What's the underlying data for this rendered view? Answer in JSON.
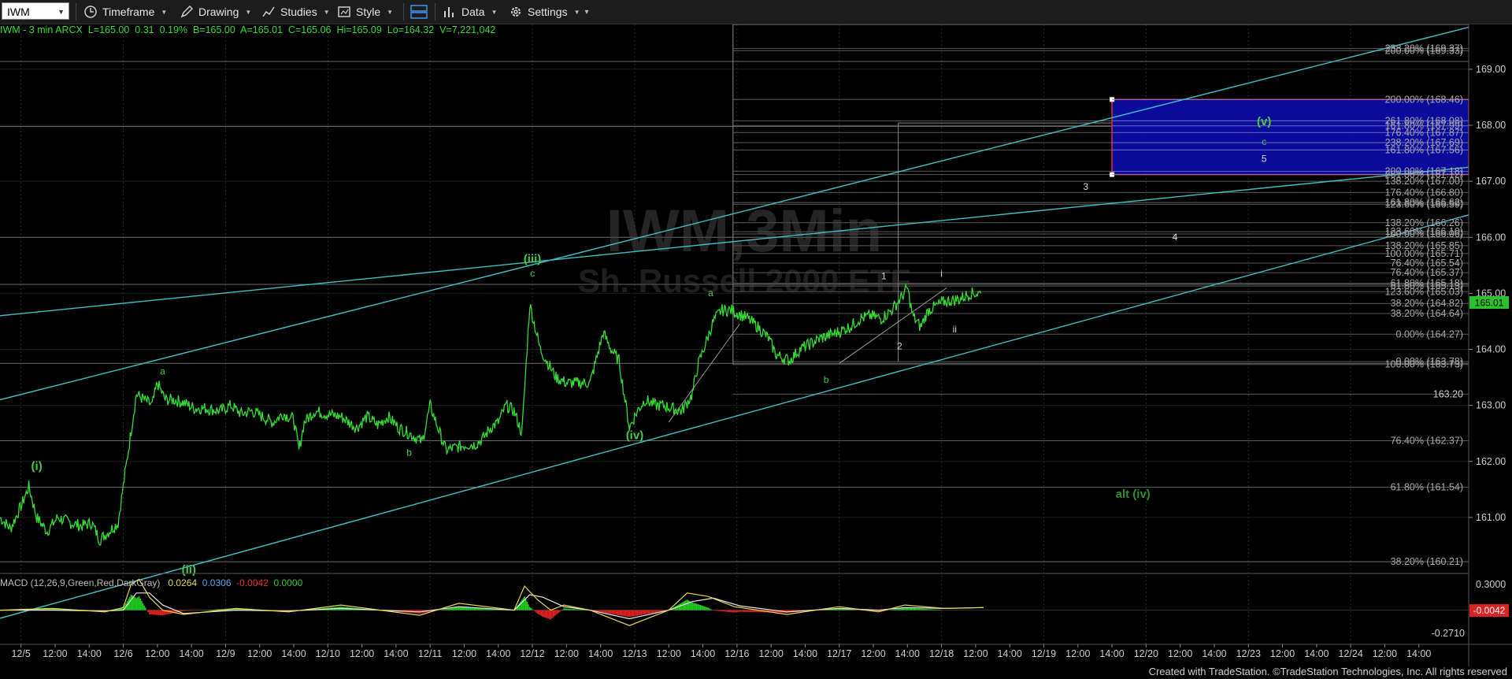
{
  "toolbar": {
    "symbol": "IWM",
    "timeframe_label": "Timeframe",
    "drawing_label": "Drawing",
    "studies_label": "Studies",
    "style_label": "Style",
    "data_label": "Data",
    "settings_label": "Settings"
  },
  "info": {
    "name": "IWM - 3 min  ARCX",
    "last": "L=165.00",
    "chg": "0.31",
    "pct": "0.19%",
    "bid": "B=165.00",
    "ask": "A=165.01",
    "close": "C=165.06",
    "hi": "Hi=165.09",
    "lo": "Lo=164.32",
    "vol": "V=7,221,042"
  },
  "watermark": {
    "line1": "IWM,3Min",
    "line2": "Sh. Russell 2000 ETF"
  },
  "macd_legend": {
    "name": "MACD (12,26,9,Green,Red,DarkGray)",
    "v1": "0.0264",
    "v2": "0.0306",
    "v3": "-0.0042",
    "v4": "0.0000"
  },
  "price_badge": "165.01",
  "macd_badge": "-0.0042",
  "credit": "Created with TradeStation. ©TradeStation Technologies, Inc. All rights reserved",
  "colors": {
    "price": "#33dd33",
    "trend": "#3fc0c8",
    "box_fill": "#0c0ca8",
    "box_border": "#dd3344",
    "wave": "#44cc44"
  },
  "chart_data": {
    "type": "line",
    "title": "IWM - 3 min ARCX",
    "y_range": [
      160.0,
      169.8
    ],
    "price_axis_ticks": [
      "161.00",
      "162.00",
      "163.00",
      "164.00",
      "165.00",
      "166.00",
      "167.00",
      "168.00",
      "169.00"
    ],
    "x_tick_labels": [
      "12/5",
      "12:00",
      "14:00",
      "12/6",
      "12:00",
      "14:00",
      "12/9",
      "12:00",
      "14:00",
      "12/10",
      "12:00",
      "14:00",
      "12/11",
      "12:00",
      "14:00",
      "12/12",
      "12:00",
      "14:00",
      "12/13",
      "12:00",
      "14:00",
      "12/16",
      "12:00",
      "14:00",
      "12/17",
      "12:00",
      "14:00",
      "12/18",
      "12:00",
      "14:00",
      "12/19",
      "12:00",
      "14:00",
      "12/20",
      "12:00",
      "14:00",
      "12/23",
      "12:00",
      "14:00",
      "12/24",
      "12:00",
      "14:00"
    ],
    "series": [
      {
        "x": [
          0,
          4,
          8,
          11,
          14,
          18,
          22,
          27,
          31,
          35,
          38,
          45,
          52,
          58,
          60,
          63,
          66,
          70,
          74,
          78,
          84,
          88,
          92,
          96,
          100,
          104,
          108,
          112,
          114,
          116,
          118,
          120,
          124,
          130,
          136,
          140,
          144,
          148,
          152,
          156,
          161,
          164,
          167,
          170,
          174,
          178,
          181,
          184,
          187,
          190,
          193,
          196,
          199,
          202,
          206,
          212,
          216,
          220,
          225,
          230,
          233,
          236,
          240,
          243,
          246,
          250,
          253,
          256,
          260,
          264,
          266,
          269,
          272,
          275,
          279,
          285,
          289,
          293,
          296,
          301,
          305,
          309,
          313,
          319,
          324,
          328,
          332,
          336,
          340,
          344,
          346,
          348,
          351,
          354,
          360,
          366,
          370,
          374
        ],
        "y": [
          161.0,
          160.8,
          161.2,
          161.55,
          161.0,
          160.75,
          161.0,
          160.9,
          160.85,
          160.9,
          160.6,
          160.9,
          163.2,
          163.0,
          163.4,
          163.1,
          163.1,
          163.05,
          162.95,
          162.95,
          162.9,
          163.0,
          162.85,
          162.9,
          162.8,
          162.7,
          162.85,
          162.75,
          162.2,
          162.7,
          162.8,
          162.9,
          162.85,
          162.8,
          162.6,
          162.8,
          162.65,
          162.8,
          162.6,
          162.5,
          162.35,
          163.0,
          162.6,
          162.2,
          162.25,
          162.3,
          162.3,
          162.4,
          162.6,
          162.7,
          163.0,
          162.9,
          162.5,
          164.8,
          164.0,
          163.5,
          163.4,
          163.4,
          163.4,
          164.3,
          164.0,
          163.8,
          162.6,
          162.9,
          163.1,
          163.0,
          163.0,
          162.95,
          162.9,
          163.2,
          163.7,
          164.1,
          164.5,
          164.7,
          164.7,
          164.55,
          164.4,
          164.2,
          163.9,
          163.8,
          164.0,
          164.1,
          164.2,
          164.3,
          164.4,
          164.55,
          164.6,
          164.55,
          164.7,
          164.95,
          165.1,
          164.6,
          164.4,
          164.7,
          164.85,
          164.9,
          165.0,
          165.0
        ]
      }
    ],
    "wave_labels": [
      {
        "t": "(i)",
        "x": 14,
        "y": 161.85,
        "c": "green",
        "b": true
      },
      {
        "t": "(ii)",
        "x": 72,
        "y": 160.0,
        "c": "green",
        "b": true
      },
      {
        "t": "a",
        "x": 62,
        "y": 163.55,
        "c": "green",
        "b": false
      },
      {
        "t": "b",
        "x": 156,
        "y": 162.1,
        "c": "green",
        "b": false
      },
      {
        "t": "(iii)",
        "x": 203,
        "y": 165.55,
        "c": "green",
        "b": true
      },
      {
        "t": "c",
        "x": 203,
        "y": 165.3,
        "c": "green",
        "b": false
      },
      {
        "t": "(iv)",
        "x": 242,
        "y": 162.4,
        "c": "green",
        "b": true
      },
      {
        "t": "a",
        "x": 271,
        "y": 164.95,
        "c": "green",
        "b": false
      },
      {
        "t": "b",
        "x": 315,
        "y": 163.4,
        "c": "green",
        "b": false
      },
      {
        "t": "1",
        "x": 337,
        "y": 165.25,
        "c": "white",
        "b": false
      },
      {
        "t": "2",
        "x": 343,
        "y": 164.0,
        "c": "white",
        "b": false
      },
      {
        "t": "i",
        "x": 359,
        "y": 165.3,
        "c": "white",
        "b": false
      },
      {
        "t": "ii",
        "x": 364,
        "y": 164.3,
        "c": "white",
        "b": false
      },
      {
        "t": "3",
        "x": 414,
        "y": 166.85,
        "c": "white",
        "b": false
      },
      {
        "t": "4",
        "x": 448,
        "y": 165.95,
        "c": "white",
        "b": false
      },
      {
        "t": "(v)",
        "x": 482,
        "y": 168.0,
        "c": "green",
        "b": true
      },
      {
        "t": "c",
        "x": 482,
        "y": 167.65,
        "c": "green",
        "b": false
      },
      {
        "t": "5",
        "x": 482,
        "y": 167.35,
        "c": "white",
        "b": false
      },
      {
        "t": "alt (iv)",
        "x": 432,
        "y": 161.35,
        "c": "darkgreen",
        "b": true
      }
    ],
    "fib_levels_outer": [
      {
        "label": "238.20% (169.37)",
        "price": 169.37
      },
      {
        "label": "200.00% (169.33)",
        "price": 169.33
      },
      {
        "label": "200.00% (168.46)",
        "price": 168.46
      },
      {
        "label": "261.80% (168.08)",
        "price": 168.08
      },
      {
        "label": "161.80% (167.99)",
        "price": 167.99
      },
      {
        "label": "176.40% (167.87)",
        "price": 167.87
      },
      {
        "label": "238.20% (167.69)",
        "price": 167.69
      },
      {
        "label": "161.80% (167.56)",
        "price": 167.56
      },
      {
        "label": "200.00% (167.18)",
        "price": 167.18
      },
      {
        "label": "261.80% (167.12)",
        "price": 167.12
      },
      {
        "label": "138.20% (167.00)",
        "price": 167.0
      },
      {
        "label": "176.40% (166.80)",
        "price": 166.8
      },
      {
        "label": "161.80% (166.62)",
        "price": 166.62
      },
      {
        "label": "123.60% (166.59)",
        "price": 166.59
      },
      {
        "label": "138.20% (166.26)",
        "price": 166.26
      },
      {
        "label": "123.60% (166.10)",
        "price": 166.1
      },
      {
        "label": "100.00% (166.06)",
        "price": 166.06
      },
      {
        "label": "138.20% (165.85)",
        "price": 165.85
      },
      {
        "label": "100.00% (165.71)",
        "price": 165.71
      },
      {
        "label": "76.40% (165.54)",
        "price": 165.54
      },
      {
        "label": "76.40% (165.37)",
        "price": 165.37
      },
      {
        "label": "61.80% (165.18)",
        "price": 165.18
      },
      {
        "label": "61.80% (165.13)",
        "price": 165.13
      },
      {
        "label": "123.60% (165.03)",
        "price": 165.03
      },
      {
        "label": "38.20% (164.82)",
        "price": 164.82
      },
      {
        "label": "38.20% (164.64)",
        "price": 164.64
      },
      {
        "label": "0.00% (164.27)",
        "price": 164.27
      },
      {
        "label": "0.00% (163.78)",
        "price": 163.78
      },
      {
        "label": "100.00% (163.73)",
        "price": 163.73
      },
      {
        "label": "163.20",
        "price": 163.2
      },
      {
        "label": "76.40% (162.37)",
        "price": 162.37
      },
      {
        "label": "61.80% (161.54)",
        "price": 161.54
      },
      {
        "label": "38.20% (160.21)",
        "price": 160.21
      }
    ],
    "fib_levels_unlabeled": [
      169.14,
      167.98,
      166.0,
      165.16,
      163.75,
      162.37,
      161.54,
      160.21
    ],
    "target_box": {
      "x0": 424,
      "x1": 560,
      "price_top": 168.46,
      "price_bottom": 167.12
    },
    "trend_lines": [
      {
        "x0": 0,
        "y0": 163.1,
        "x1": 560,
        "y1": 169.75
      },
      {
        "x0": 0,
        "y0": 164.6,
        "x1": 560,
        "y1": 167.25
      },
      {
        "x0": 0,
        "y0": 159.2,
        "x1": 560,
        "y1": 166.4
      }
    ],
    "projection_lines": [
      {
        "x0": 255,
        "y0": 162.7,
        "x1": 282,
        "y1": 164.45
      },
      {
        "x0": 320,
        "y0": 163.75,
        "x1": 361,
        "y1": 165.1
      }
    ],
    "fib_anchor_boxes": [
      {
        "x": 279.5,
        "top": 169.8,
        "bottom": 163.73
      },
      {
        "x": 342.5,
        "top": 168.04,
        "bottom": 163.78
      }
    ],
    "day_separators": [
      8,
      47,
      86,
      125,
      164,
      203,
      242,
      281,
      320,
      359,
      398,
      437,
      476,
      515
    ],
    "macd": {
      "y_range": [
        -0.38,
        0.4
      ],
      "ticks": [
        "0.3000",
        "-0.2710"
      ],
      "lines": {
        "macd": {
          "x": [
            0,
            20,
            40,
            47,
            50,
            53,
            57,
            62,
            70,
            90,
            110,
            130,
            160,
            175,
            196,
            200,
            205,
            210,
            215,
            225,
            240,
            255,
            262,
            270,
            280,
            300,
            320,
            335,
            345,
            360,
            375
          ],
          "y": [
            0.0,
            0.02,
            -0.02,
            0.03,
            0.3,
            0.36,
            0.15,
            0.0,
            -0.05,
            0.02,
            -0.02,
            0.06,
            -0.06,
            0.08,
            0.0,
            0.28,
            0.12,
            0.0,
            0.06,
            0.0,
            -0.18,
            0.0,
            0.2,
            0.16,
            0.04,
            -0.05,
            0.04,
            -0.02,
            0.06,
            0.02,
            0.03
          ]
        },
        "signal": {
          "x": [
            0,
            20,
            40,
            47,
            52,
            57,
            62,
            70,
            90,
            110,
            130,
            160,
            175,
            196,
            202,
            207,
            215,
            225,
            240,
            255,
            264,
            272,
            282,
            300,
            320,
            335,
            345,
            360,
            375
          ],
          "y": [
            0.0,
            0.0,
            -0.01,
            0.0,
            0.2,
            0.2,
            0.06,
            -0.04,
            0.0,
            -0.01,
            0.02,
            -0.02,
            0.04,
            0.0,
            0.18,
            0.15,
            0.04,
            0.0,
            -0.1,
            0.0,
            0.1,
            0.14,
            0.05,
            -0.02,
            0.02,
            0.0,
            0.03,
            0.02,
            0.03
          ]
        }
      }
    }
  }
}
